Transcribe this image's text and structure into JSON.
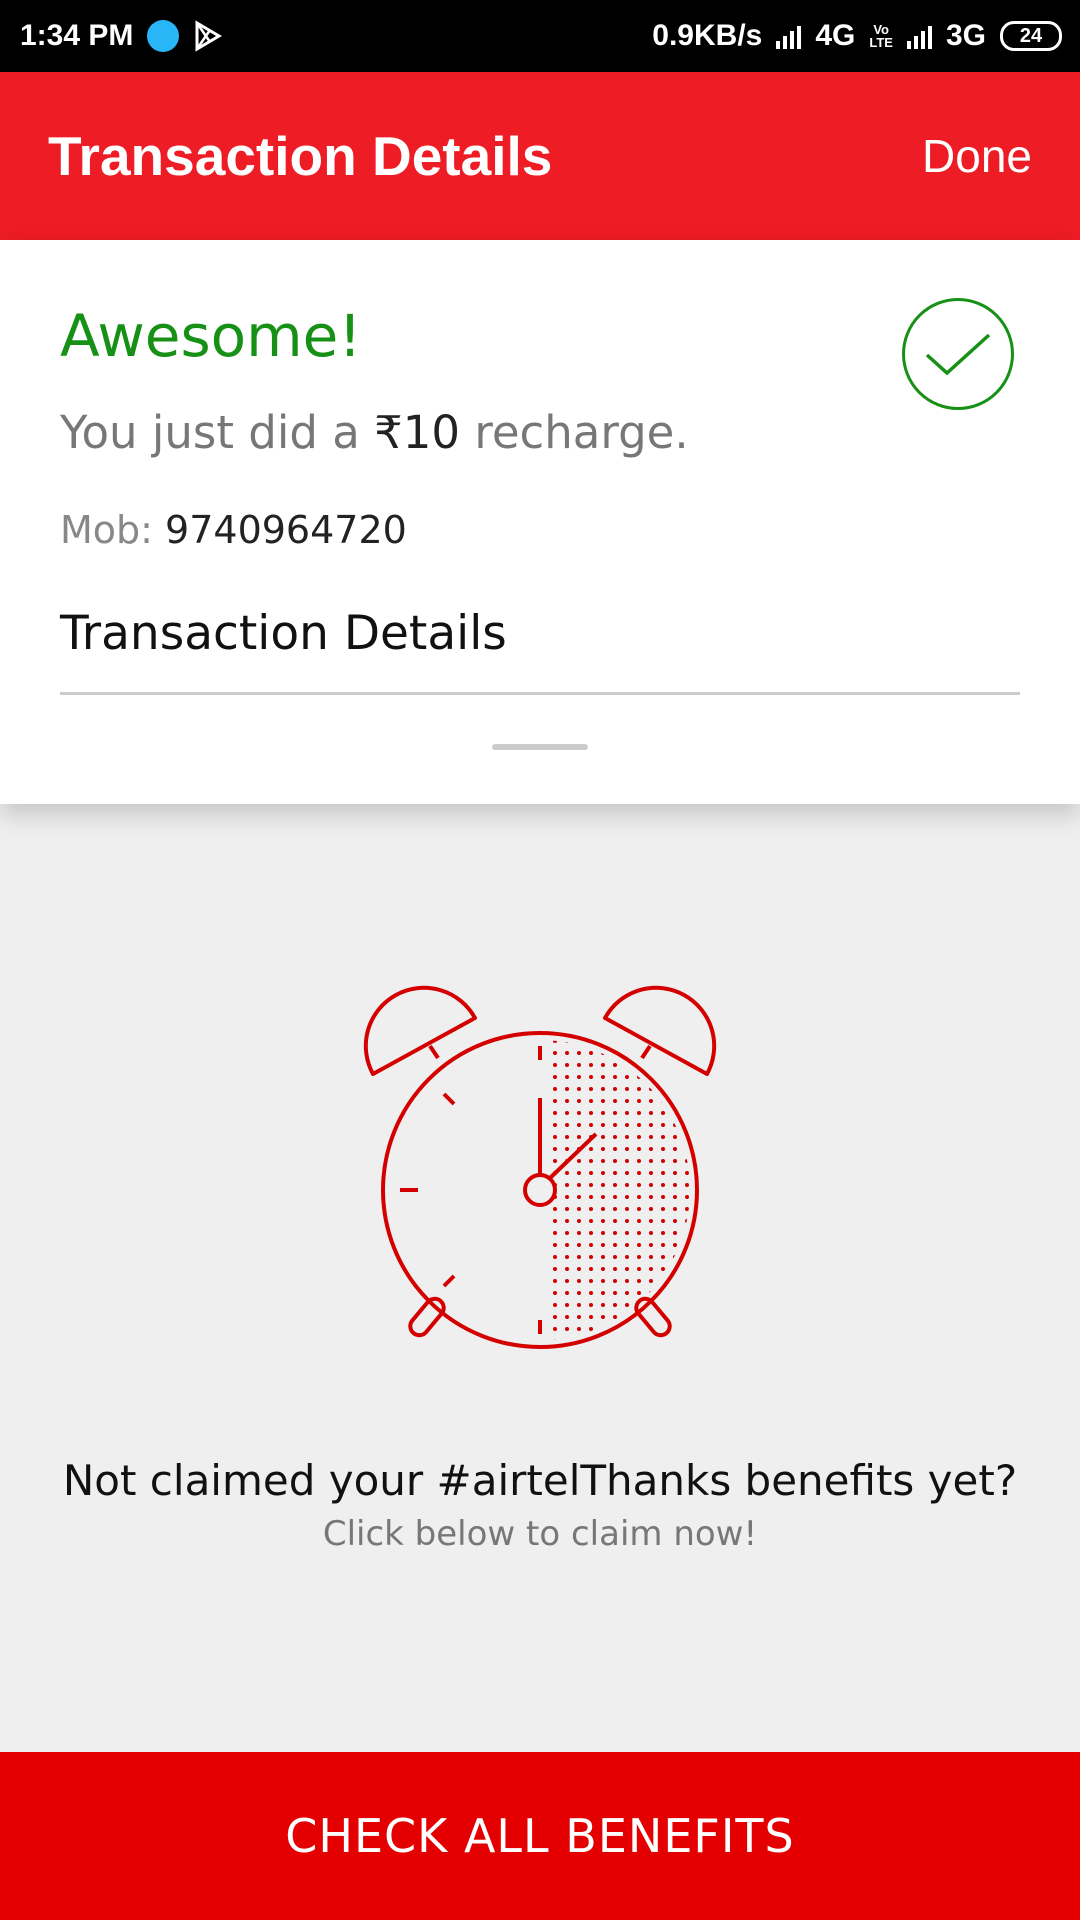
{
  "status_bar": {
    "time": "1:34 PM",
    "net_speed": "0.9KB/s",
    "network1": "4G",
    "volte_top": "Vo",
    "volte_bottom": "LTE",
    "network2": "3G",
    "battery": "24"
  },
  "app_bar": {
    "title": "Transaction Details",
    "done_label": "Done"
  },
  "summary": {
    "headline": "Awesome!",
    "recharge_prefix": "You just did a ",
    "recharge_amount": "₹10",
    "recharge_suffix": " recharge.",
    "mob_label": "Mob: ",
    "mob_number": "9740964720",
    "section_title": "Transaction Details"
  },
  "promo": {
    "title": "Not claimed your #airtelThanks benefits yet?",
    "subtitle": "Click below to claim now!"
  },
  "cta": {
    "label": "CHECK ALL BENEFITS"
  },
  "colors": {
    "brand_red": "#ee1c25",
    "cta_red": "#e40000",
    "success_green": "#169116"
  },
  "icons": [
    "wifi-app-icon",
    "play-store-icon",
    "signal-icon",
    "battery-icon",
    "check-circle-icon",
    "alarm-clock-icon"
  ]
}
